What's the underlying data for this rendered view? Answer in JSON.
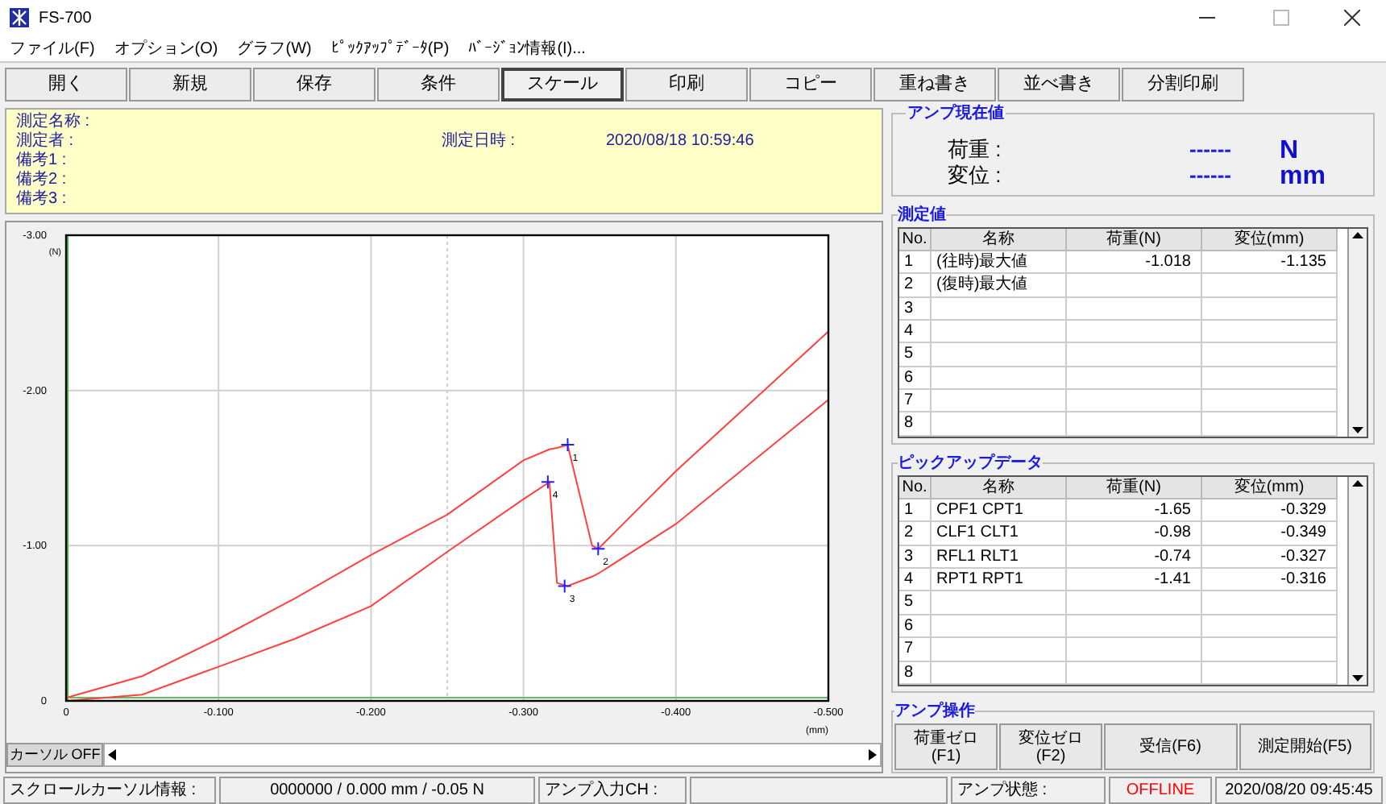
{
  "window": {
    "title": "FS-700"
  },
  "menu": [
    "ファイル(F)",
    "オプション(O)",
    "グラフ(W)",
    "ﾋﾟｯｸｱｯﾌﾟﾃﾞｰﾀ(P)",
    "ﾊﾞｰｼﾞｮﾝ情報(I)..."
  ],
  "toolbar": [
    {
      "label": "開く",
      "selected": false
    },
    {
      "label": "新規",
      "selected": false
    },
    {
      "label": "保存",
      "selected": false
    },
    {
      "label": "条件",
      "selected": false
    },
    {
      "label": "スケール",
      "selected": true
    },
    {
      "label": "印刷",
      "selected": false
    },
    {
      "label": "コピー",
      "selected": false
    },
    {
      "label": "重ね書き",
      "selected": false
    },
    {
      "label": "並べ書き",
      "selected": false
    },
    {
      "label": "分割印刷",
      "selected": false
    }
  ],
  "info": {
    "name_label": "測定名称 :",
    "operator_label": "測定者 :",
    "datetime_label": "測定日時 :",
    "datetime": "2020/08/18 10:59:46",
    "notes": [
      "備考1 :",
      "備考2 :",
      "備考3 :"
    ]
  },
  "chart": {
    "chart_data": {
      "type": "line",
      "xlabel": "(mm)",
      "ylabel": "(N)",
      "xlim": [
        0,
        -0.5
      ],
      "ylim": [
        0,
        -3
      ],
      "xticks": [
        {
          "value": 0,
          "label": "0"
        },
        {
          "value": -0.1,
          "label": "-0.100"
        },
        {
          "value": -0.2,
          "label": "-0.200"
        },
        {
          "value": -0.3,
          "label": "-0.300"
        },
        {
          "value": -0.4,
          "label": "-0.400"
        },
        {
          "value": -0.5,
          "label": "-0.500"
        }
      ],
      "yticks": [
        {
          "value": 0,
          "label": "0"
        },
        {
          "value": -1,
          "label": "-1.00"
        },
        {
          "value": -2,
          "label": "-2.00"
        },
        {
          "value": -3,
          "label": "-3.00"
        }
      ],
      "x": [
        0,
        -0.05,
        -0.1,
        -0.15,
        -0.2,
        -0.25,
        -0.3,
        -0.317,
        -0.322,
        -0.329,
        -0.345,
        -0.349,
        -0.4,
        -0.45,
        -0.5
      ],
      "series": [
        {
          "color": "#ff4040",
          "values": [
            -0.02,
            -0.16,
            -0.4,
            -0.66,
            -0.94,
            -1.2,
            -1.55,
            -1.62,
            -1.63,
            -1.65,
            -1.0,
            -0.98,
            -1.48,
            -1.93,
            -2.38
          ]
        },
        {
          "color": "#ff4040",
          "values": [
            0,
            -0.04,
            -0.22,
            -0.4,
            -0.61,
            -0.96,
            -1.3,
            -1.41,
            -0.76,
            -0.74,
            -0.8,
            -0.82,
            -1.14,
            -1.54,
            -1.94
          ]
        }
      ],
      "grid": true,
      "ref_lines": [
        {
          "axis": "x",
          "value": -0.25
        }
      ]
    },
    "markers": [
      "1",
      "2",
      "3",
      "4"
    ],
    "cursor_button": "カーソル OFF"
  },
  "amp_current": {
    "title": "アンプ現在値",
    "rows": [
      {
        "label": "荷重 :",
        "value": "------",
        "unit": "N"
      },
      {
        "label": "変位 :",
        "value": "------",
        "unit": "mm"
      }
    ]
  },
  "measured": {
    "title": "測定値",
    "columns": [
      "No.",
      "名称",
      "荷重(N)",
      "変位(mm)"
    ],
    "rows": [
      {
        "no": "1",
        "name": "(往時)最大値",
        "load": "-1.018",
        "disp": "-1.135"
      },
      {
        "no": "2",
        "name": "(復時)最大値"
      },
      {
        "no": "3"
      },
      {
        "no": "4"
      },
      {
        "no": "5"
      },
      {
        "no": "6"
      },
      {
        "no": "7"
      },
      {
        "no": "8"
      }
    ]
  },
  "pickup": {
    "title": "ピックアップデータ",
    "columns": [
      "No.",
      "名称",
      "荷重(N)",
      "変位(mm)"
    ],
    "rows": [
      {
        "no": "1",
        "name": "CPF1 CPT1",
        "load": "-1.65",
        "disp": "-0.329"
      },
      {
        "no": "2",
        "name": "CLF1 CLT1",
        "load": "-0.98",
        "disp": "-0.349"
      },
      {
        "no": "3",
        "name": "RFL1 RLT1",
        "load": "-0.74",
        "disp": "-0.327"
      },
      {
        "no": "4",
        "name": "RPT1 RPT1",
        "load": "-1.41",
        "disp": "-0.316"
      },
      {
        "no": "5"
      },
      {
        "no": "6"
      },
      {
        "no": "7"
      },
      {
        "no": "8"
      }
    ]
  },
  "amp_ops": {
    "title": "アンプ操作",
    "buttons": [
      "荷重ゼロ\n(F1)",
      "変位ゼロ\n(F2)",
      "受信(F6)",
      "測定開始(F5)"
    ]
  },
  "status_bar": [
    {
      "kind": "label",
      "text": "スクロールカーソル情報 :"
    },
    {
      "kind": "value",
      "text": "0000000 / 0.000 mm / -0.05 N"
    },
    {
      "kind": "label",
      "text": "アンプ入力CH :"
    },
    {
      "kind": "empty"
    },
    {
      "kind": "label",
      "text": "アンプ状態 :"
    },
    {
      "kind": "alert",
      "text": "OFFLINE"
    },
    {
      "kind": "value",
      "text": "2020/08/20 09:45:45"
    }
  ]
}
